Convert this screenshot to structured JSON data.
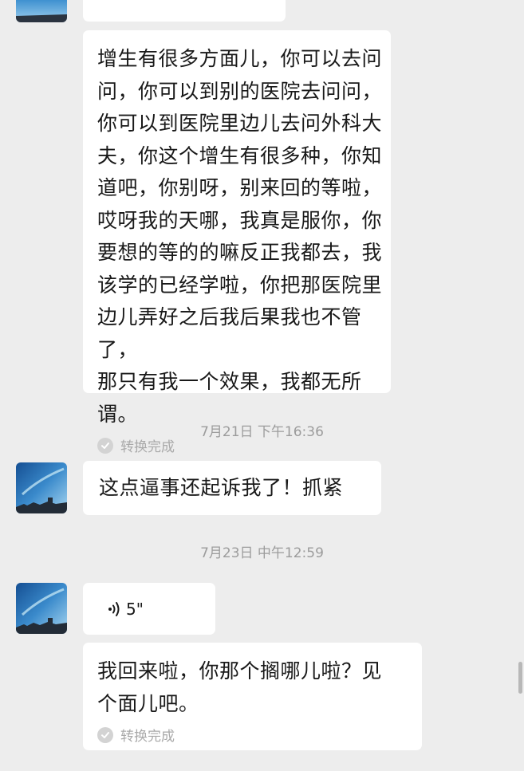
{
  "messages": [
    {
      "type": "voice-transcript",
      "text": "增生有很多方面儿，你可以去问\n问，你可以到别的医院去问问，\n你可以到医院里边儿去问外科大\n夫，你这个增生有很多种，你知\n道吧，你别呀，别来回的等啦，\n哎呀我的天哪，我真是服你，你\n要想的等的的嘛反正我都去，我\n该学的已经学啦，你把那医院里\n边儿弄好之后我后果我也不管了，\n那只有我一个效果，我都无所谓。",
      "status": "转换完成"
    },
    {
      "type": "time",
      "text": "7月21日 下午16:36"
    },
    {
      "type": "text",
      "text": "这点逼事还起诉我了！抓紧"
    },
    {
      "type": "time",
      "text": "7月23日 中午12:59"
    },
    {
      "type": "voice",
      "duration": "5\""
    },
    {
      "type": "voice-transcript",
      "text": "我回来啦，你那个搁哪儿啦？见\n个面儿吧。",
      "status": "转换完成"
    }
  ]
}
